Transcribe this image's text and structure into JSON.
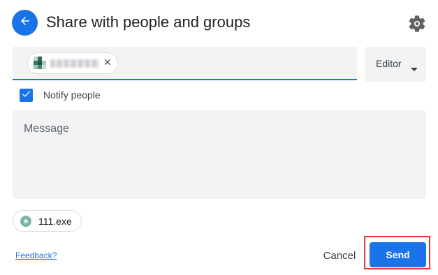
{
  "header": {
    "title": "Share with people and groups",
    "back_icon": "arrow-left-icon",
    "settings_icon": "gear-icon"
  },
  "recipients": {
    "chip_name": "",
    "remove_icon": "close-icon"
  },
  "role": {
    "label": "Editor",
    "caret_icon": "caret-down-icon"
  },
  "notify": {
    "checked": true,
    "label": "Notify people"
  },
  "message": {
    "placeholder": "Message"
  },
  "file_chip": {
    "name": "111.exe",
    "icon": "file-icon"
  },
  "footer": {
    "feedback_link": "Feedback?",
    "cancel_label": "Cancel",
    "send_label": "Send"
  },
  "colors": {
    "primary": "#1a73e8",
    "field_bg": "#f1f3f4",
    "highlight": "#e53935"
  }
}
